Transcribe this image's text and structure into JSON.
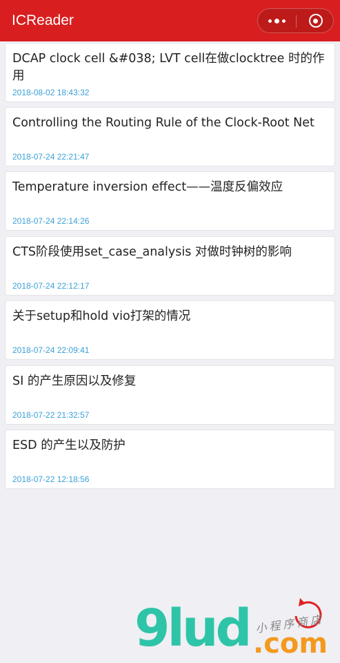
{
  "app": {
    "title": "ICReader"
  },
  "capsule": {
    "more_icon": "more-dots-icon",
    "close_icon": "target-close-icon"
  },
  "posts": [
    {
      "title": "DCAP clock cell &#038; LVT cell在做clocktree 时的作用",
      "date": "2018-08-02 18:43:32"
    },
    {
      "title": "Controlling the Routing Rule of the Clock-Root Net",
      "date": "2018-07-24 22:21:47"
    },
    {
      "title": "Temperature inversion effect——温度反偏效应",
      "date": "2018-07-24 22:14:26"
    },
    {
      "title": "CTS阶段使用set_case_analysis 对做时钟树的影响",
      "date": "2018-07-24 22:12:17"
    },
    {
      "title": "关于setup和hold vio打架的情况",
      "date": "2018-07-24 22:09:41"
    },
    {
      "title": "SI 的产生原因以及修复",
      "date": "2018-07-22 21:32:57"
    },
    {
      "title": "ESD 的产生以及防护",
      "date": "2018-07-22 12:18:56"
    }
  ],
  "watermark": {
    "brand": "9lud",
    "domain": ".com",
    "slogan": "小程序商店"
  },
  "colors": {
    "navbar": "#d81e1e",
    "date": "#3aa0d8",
    "background": "#efeff4",
    "brand_green": "#2ec4a8",
    "brand_orange": "#f39a1e"
  }
}
